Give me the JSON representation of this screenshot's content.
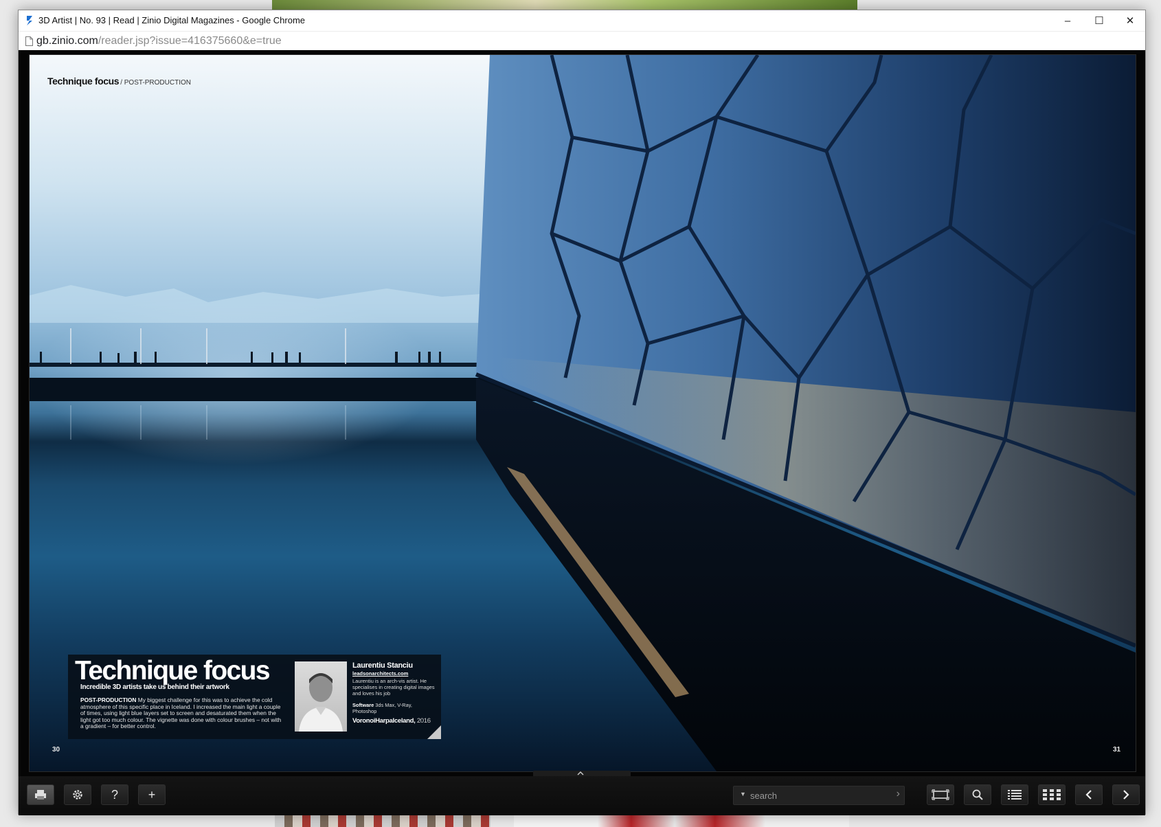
{
  "window": {
    "title": "3D Artist | No. 93 | Read | Zinio Digital Magazines - Google Chrome",
    "controls": {
      "minimize": "–",
      "maximize": "☐",
      "close": "✕"
    }
  },
  "address": {
    "host": "gb.zinio.com",
    "path": "/reader.jsp?issue=416375660&e=true"
  },
  "page": {
    "header_title": "Technique focus",
    "header_section": "/ POST-PRODUCTION",
    "left_page_number": "30",
    "right_page_number": "31"
  },
  "info_box": {
    "title": "Technique focus",
    "subtitle": "Incredible 3D artists take us behind their artwork",
    "body_label": "POST-PRODUCTION",
    "body_text": " My biggest challenge for this was to achieve the cold atmosphere of this specific place in Iceland. I increased the main light a couple of times, using light blue layers set to screen and desaturated them when the light got too much colour. The vignette was done with colour brushes – not with a gradient – for better control.",
    "artist_name": "Laurentiu Stanciu",
    "artist_site": "leadsonarchitects.com",
    "artist_bio": "Laurentiu is an arch-vis artist. He specialises in creating digital images and loves his job",
    "software_label": "Software",
    "software_value": " 3ds Max, V-Ray, Photoshop",
    "artwork_title": "VoronoiHarpaIceland,",
    "artwork_year": " 2016"
  },
  "toolbar": {
    "search_placeholder": "search",
    "icons": [
      "print-icon",
      "settings-icon",
      "help-icon",
      "add-icon",
      "fit-page-icon",
      "zoom-icon",
      "list-view-icon",
      "grid-view-icon",
      "previous-page-icon",
      "next-page-icon"
    ],
    "help_glyph": "?",
    "add_glyph": "+"
  }
}
